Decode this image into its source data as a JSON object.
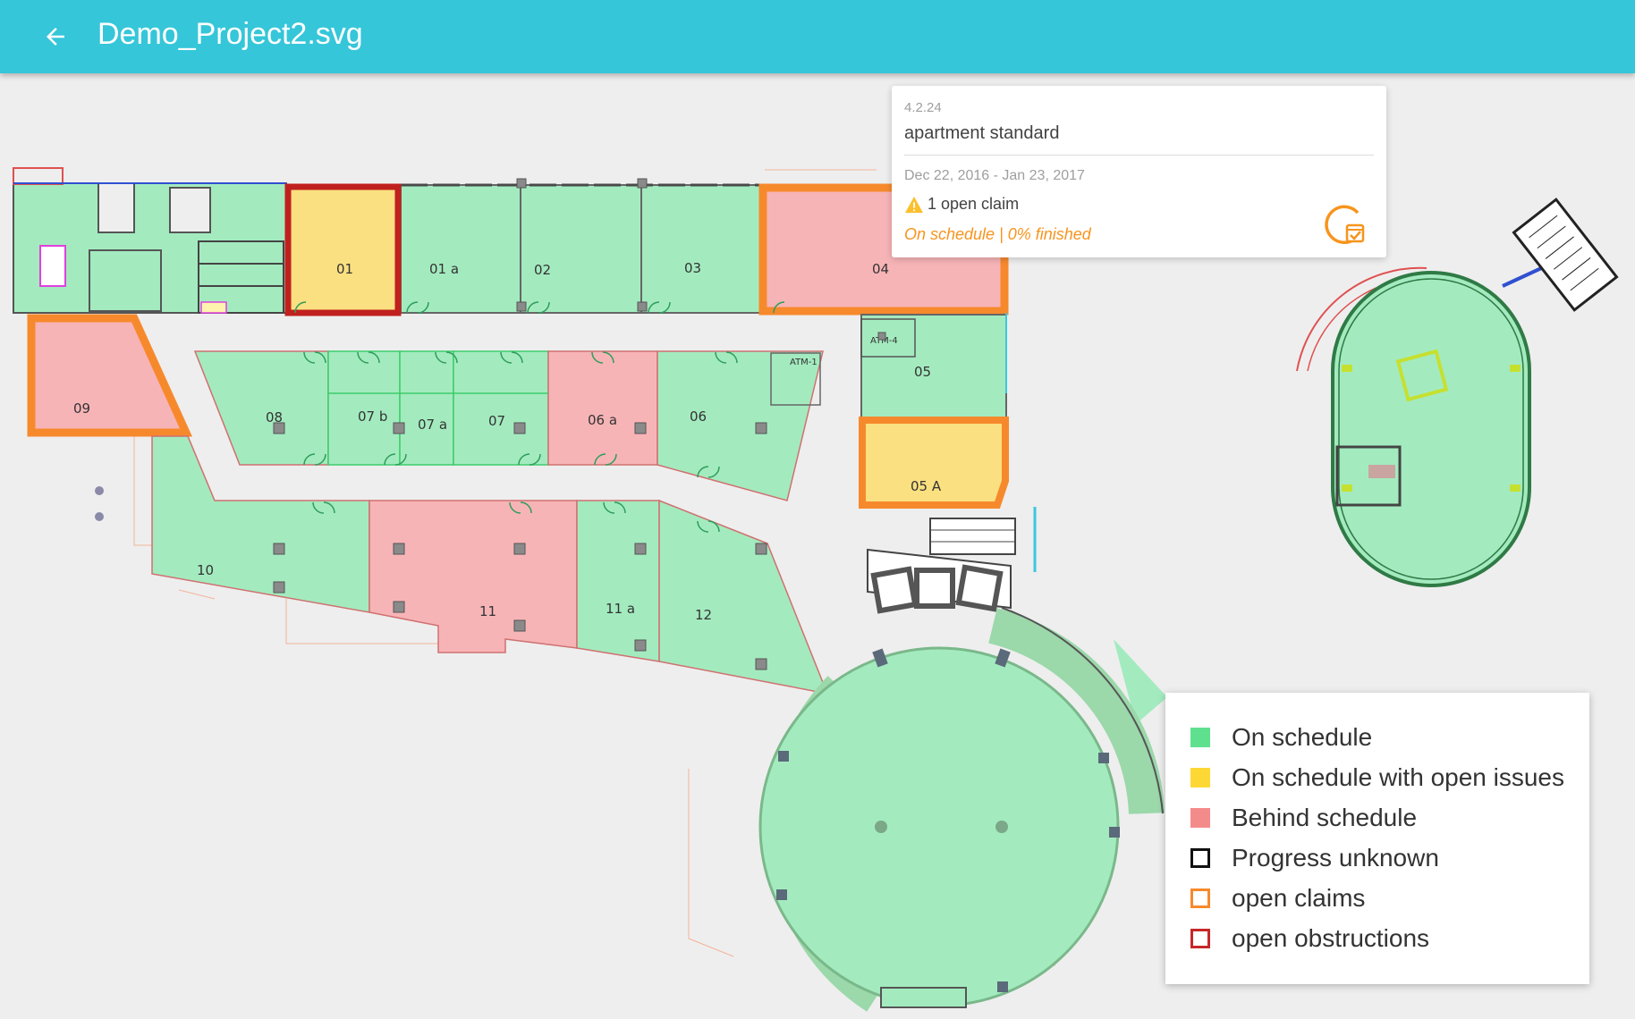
{
  "header": {
    "title": "Demo_Project2.svg",
    "back_icon": "arrow-left-icon"
  },
  "popup": {
    "code": "4.2.24",
    "name": "apartment standard",
    "dates": "Dec 22, 2016 - Jan 23, 2017",
    "claims": "1 open claim",
    "status": "On schedule | 0% finished",
    "warning_icon": "warning-icon",
    "schedule_icon": "schedule-calendar-icon"
  },
  "legend": {
    "items": [
      {
        "label": "On schedule",
        "color": "#5fe08f",
        "style": "fill"
      },
      {
        "label": "On schedule with open issues",
        "color": "#fdd835",
        "style": "fill"
      },
      {
        "label": "Behind schedule",
        "color": "#f48b8b",
        "style": "fill"
      },
      {
        "label": "Progress unknown",
        "color": "#111111",
        "style": "outline"
      },
      {
        "label": "open claims",
        "color": "#f7892d",
        "style": "outline"
      },
      {
        "label": "open obstructions",
        "color": "#c62828",
        "style": "outline"
      }
    ]
  },
  "rooms": {
    "r01": "01",
    "r01a": "01 a",
    "r02": "02",
    "r03": "03",
    "r04": "04",
    "r05": "05",
    "r05A": "05 A",
    "r06": "06",
    "r06a": "06 a",
    "r07": "07",
    "r07a": "07 a",
    "r07b": "07 b",
    "r08": "08",
    "r09": "09",
    "r10": "10",
    "r11": "11",
    "r11a": "11 a",
    "r12": "12",
    "atm1": "ATM-1",
    "atm4": "ATM-4"
  },
  "colors": {
    "green": "#a3ebbf",
    "yellow": "#fae080",
    "red": "#f7b4b7",
    "orange": "#f7892d",
    "darkred": "#c0201e",
    "appbar": "#35c6d9"
  }
}
